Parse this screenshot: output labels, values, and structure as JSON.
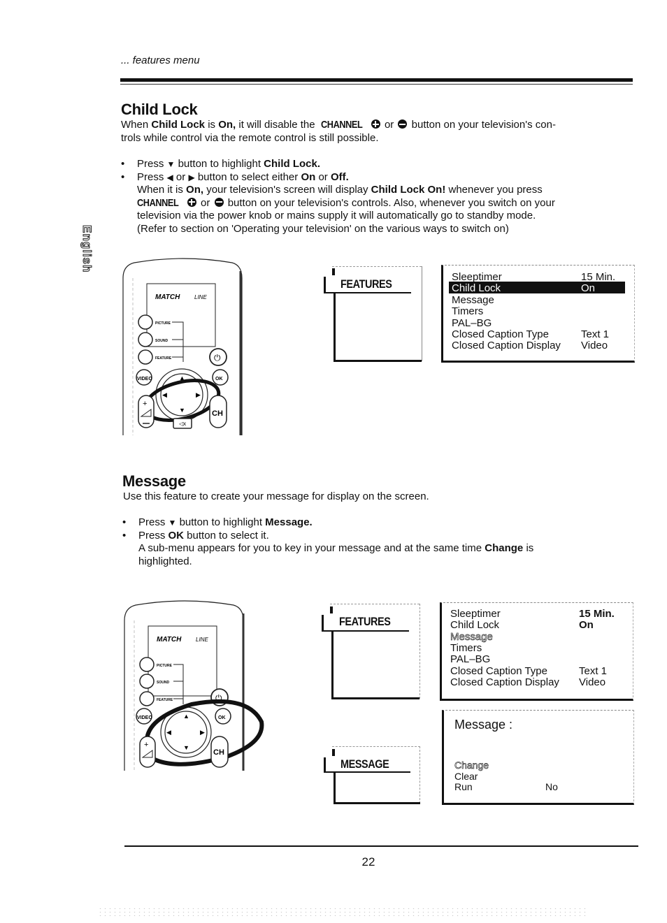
{
  "header": {
    "section": "... features menu"
  },
  "side_tab": {
    "language": "English"
  },
  "child_lock": {
    "title": "Child Lock",
    "intro": {
      "p1": "When ",
      "b1": "Child Lock",
      "p2": " is ",
      "b2": "On,",
      "p3": " it will disable the ",
      "b3": "CHANNEL",
      "p4": " or ",
      "p5": " button on your television's con-",
      "line2": "trols while control via the remote control is still possible."
    },
    "bullets": [
      {
        "press": "Press",
        "icon": "down-triangle",
        "text": " button to highlight ",
        "bold": "Child Lock."
      },
      {
        "press": "Press",
        "icon1": "left-triangle",
        "or": " or ",
        "icon2": "right-triangle",
        "text": " button to select either ",
        "bold1": "On",
        "or2": " or ",
        "bold2": "Off."
      }
    ],
    "detail": {
      "l1a": "When it is ",
      "l1b": "On,",
      "l1c": " your television's screen will display ",
      "l1d": "Child Lock On!",
      "l1e": " whenever you press",
      "l2a": "CHANNEL",
      "l2b": " or ",
      "l2c": " button on your television's controls. Also, whenever you switch on your",
      "l3": "television via the power knob or mains supply it will automatically go to standby mode.",
      "l4": "(Refer to section on 'Operating your television' on the various ways to switch on)"
    }
  },
  "remote": {
    "brand": "MATCH",
    "brand_suffix": "LINE",
    "buttons": {
      "picture": "PICTURE",
      "sound": "SOUND",
      "feature": "FEATURE",
      "video": "VIDEO",
      "ok": "OK",
      "ch": "CH"
    }
  },
  "features_tab": {
    "label": "FEATURES"
  },
  "message_tab": {
    "label": "MESSAGE"
  },
  "menu1": {
    "items": [
      {
        "label": "Sleeptimer",
        "value": "15 Min."
      },
      {
        "label": "Child Lock",
        "value": "On",
        "highlighted": true
      },
      {
        "label": "Message",
        "value": ""
      },
      {
        "label": "Timers",
        "value": ""
      },
      {
        "label": "PAL–BG",
        "value": ""
      },
      {
        "label": "Closed Caption Type",
        "value": "Text 1"
      },
      {
        "label": "Closed Caption Display",
        "value": "Video"
      }
    ]
  },
  "menu2": {
    "items": [
      {
        "label": "Sleeptimer",
        "value": "15 Min."
      },
      {
        "label": "Child Lock",
        "value": "On"
      },
      {
        "label": "Message",
        "value": "",
        "highlighted": true
      },
      {
        "label": "Timers",
        "value": ""
      },
      {
        "label": "PAL–BG",
        "value": ""
      },
      {
        "label": "Closed Caption Type",
        "value": "Text 1"
      },
      {
        "label": "Closed Caption Display",
        "value": "Video"
      }
    ]
  },
  "message_menu": {
    "title": "Message :",
    "items": [
      {
        "label": "Change",
        "value": "",
        "highlighted": true
      },
      {
        "label": "Clear",
        "value": ""
      },
      {
        "label": "Run",
        "value": "No"
      }
    ]
  },
  "message": {
    "title": "Message",
    "intro": "Use this feature to create your message for display on the screen.",
    "bullets": [
      {
        "press": "Press",
        "text": " button to highlight ",
        "bold": "Message."
      },
      {
        "press": "Press ",
        "bold": "OK",
        "text": " button to select it."
      }
    ],
    "detail": {
      "l1a": "A sub-menu appears for you to key in your message and  at the same time ",
      "l1b": "Change",
      "l1c": " is",
      "l2": "highlighted."
    }
  },
  "footer": {
    "page_number": "22"
  }
}
